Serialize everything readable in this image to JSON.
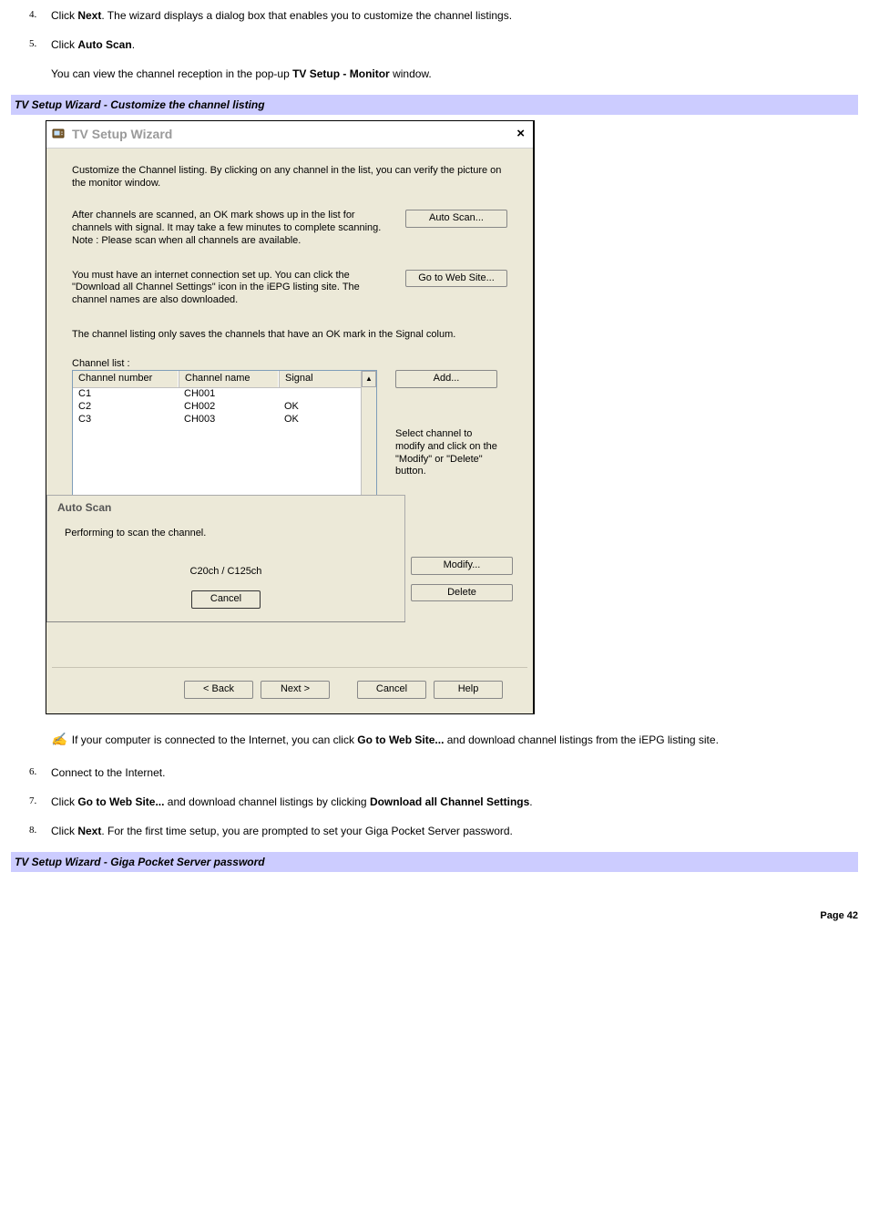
{
  "steps": {
    "s4": {
      "num": "4.",
      "prefix": "Click ",
      "bold": "Next",
      "suffix": ". The wizard displays a dialog box that enables you to customize the channel listings."
    },
    "s5": {
      "num": "5.",
      "prefix": "Click ",
      "bold": "Auto Scan",
      "suffix": ".",
      "para_a": "You can view the channel reception in the pop-up ",
      "para_b": "TV Setup - Monitor",
      "para_c": " window."
    },
    "s6": {
      "num": "6.",
      "text": "Connect to the Internet."
    },
    "s7": {
      "num": "7.",
      "prefix": "Click ",
      "bold1": "Go to Web Site...",
      "mid": " and download channel listings by clicking ",
      "bold2": "Download all Channel Settings",
      "suffix": "."
    },
    "s8": {
      "num": "8.",
      "prefix": "Click ",
      "bold": "Next",
      "suffix": ". For the first time setup, you are prompted to set your Giga Pocket Server password."
    }
  },
  "captions": {
    "c1": "TV Setup Wizard - Customize the channel listing",
    "c2": "TV Setup Wizard - Giga Pocket Server password"
  },
  "note": {
    "prefix": " If your computer is connected to the Internet, you can click ",
    "bold": "Go to Web Site...",
    "suffix": " and download channel listings from the iEPG listing site."
  },
  "dialog": {
    "title": "TV Setup Wizard",
    "close": "×",
    "intro": "Customize the Channel listing. By clicking on any channel in the list, you can verify the picture on the monitor window.",
    "scan_text": "After channels are scanned, an OK mark shows up in the list for channels with signal. It may take a few minutes to complete scanning.\nNote : Please scan when all channels are available.",
    "web_text": "You must have an internet connection set up. You can click the \"Download all Channel Settings\" icon in the iEPG listing site. The channel names are also downloaded.",
    "listing_note": "The channel listing only saves the channels that have an OK mark in the Signal colum.",
    "channel_list_label": "Channel list :",
    "columns": {
      "num": "Channel number",
      "name": "Channel name",
      "sig": "Signal"
    },
    "rows": [
      {
        "num": "C1",
        "name": "CH001",
        "sig": ""
      },
      {
        "num": "C2",
        "name": "CH002",
        "sig": "OK"
      },
      {
        "num": "C3",
        "name": "CH003",
        "sig": "OK"
      }
    ],
    "right_hint": "Select channel to modify and click on the \"Modify\" or \"Delete\" button.",
    "buttons": {
      "auto_scan": "Auto Scan...",
      "go_web": "Go to Web Site...",
      "add": "Add...",
      "modify": "Modify...",
      "delete": "Delete",
      "back": "< Back",
      "next": "Next >",
      "cancel": "Cancel",
      "help": "Help"
    },
    "autoscan": {
      "title": "Auto Scan",
      "msg": "Performing to scan the channel.",
      "progress": "C20ch / C125ch",
      "cancel": "Cancel"
    }
  },
  "page": "Page 42"
}
